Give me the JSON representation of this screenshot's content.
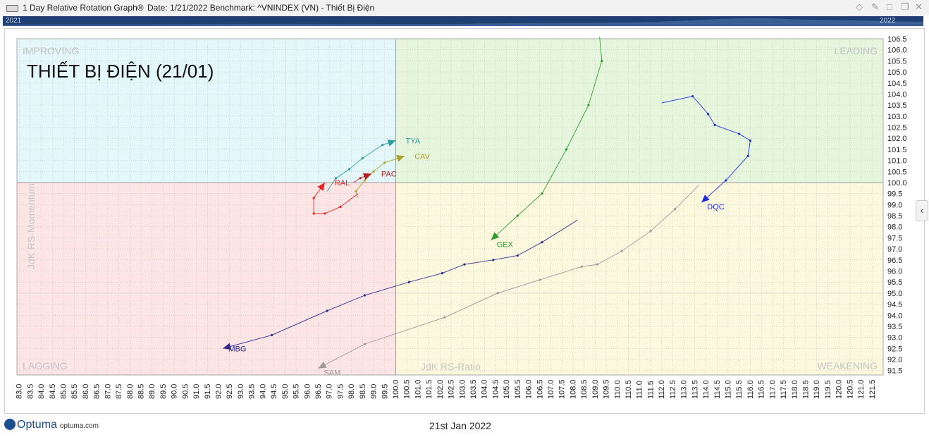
{
  "window": {
    "title": "1 Day Relative Rotation Graph®",
    "info": "Date: 1/21/2022   Benchmark:  ^VNINDEX (VN) - Thiết Bị Điện",
    "icons": [
      "pin-icon",
      "maximize-icon",
      "close-icon"
    ]
  },
  "timeline": {
    "start_label": "2021",
    "end_label": "2022"
  },
  "footer": {
    "brand": "Optuma",
    "url": "optuma.com",
    "date": "21st Jan 2022"
  },
  "colors": {
    "improving": "#e4f8fb",
    "leading": "#e6f6dd",
    "lagging": "#fde5e6",
    "weakening": "#fbf8dd",
    "timeline": "#1f3f72"
  },
  "chart_data": {
    "type": "scatter",
    "title": "THIẾT BỊ ĐIỆN (21/01)",
    "xlabel": "JdK RS-Ratio",
    "ylabel": "JdK RS-Momentum",
    "xlim": [
      82.9,
      122
    ],
    "ylim": [
      91.3,
      106.5
    ],
    "center": [
      100,
      100
    ],
    "x_ticks": [
      83.0,
      83.5,
      84.0,
      84.5,
      85.0,
      85.5,
      86.0,
      86.5,
      87.0,
      87.5,
      88.0,
      88.5,
      89.0,
      89.5,
      90.0,
      90.5,
      91.0,
      91.5,
      92.0,
      92.5,
      93.0,
      93.5,
      94.0,
      94.5,
      95.0,
      95.5,
      96.0,
      96.5,
      97.0,
      97.5,
      98.0,
      98.5,
      99.0,
      99.5,
      100.0,
      100.5,
      101.0,
      101.5,
      102.0,
      102.5,
      103.0,
      103.5,
      104.0,
      104.5,
      105.0,
      105.5,
      106.0,
      106.5,
      107.0,
      107.5,
      108.0,
      108.5,
      109.0,
      109.5,
      110.0,
      110.5,
      111.0,
      111.5,
      112.0,
      112.5,
      113.0,
      113.5,
      114.0,
      114.5,
      115.0,
      115.5,
      116.0,
      116.5,
      117.0,
      117.5,
      118.0,
      118.5,
      119.0,
      119.5,
      120.0,
      120.5,
      121.0,
      121.5
    ],
    "y_ticks": [
      91.5,
      92.0,
      92.5,
      93.0,
      93.5,
      94.0,
      94.5,
      95.0,
      95.5,
      96.0,
      96.5,
      97.0,
      97.5,
      98.0,
      98.5,
      99.0,
      99.5,
      100.0,
      100.5,
      101.0,
      101.5,
      102.0,
      102.5,
      103.0,
      103.5,
      104.0,
      104.5,
      105.0,
      105.5,
      106.0,
      106.5
    ],
    "quadrants": [
      {
        "name": "IMPROVING",
        "position": "top-left"
      },
      {
        "name": "LEADING",
        "position": "top-right"
      },
      {
        "name": "LAGGING",
        "position": "bottom-left"
      },
      {
        "name": "WEAKENING",
        "position": "bottom-right"
      }
    ],
    "series": [
      {
        "name": "TYA",
        "color": "#2a9d9d",
        "points": [
          [
            96.9,
            99.6
          ],
          [
            97.3,
            100.2
          ],
          [
            97.9,
            100.6
          ],
          [
            98.5,
            101.1
          ],
          [
            99.4,
            101.7
          ],
          [
            100.0,
            101.9
          ]
        ]
      },
      {
        "name": "CAV",
        "color": "#a9a226",
        "points": [
          [
            98.3,
            99.3
          ],
          [
            98.2,
            99.6
          ],
          [
            98.6,
            100.1
          ],
          [
            99.0,
            100.5
          ],
          [
            99.5,
            100.9
          ],
          [
            100.4,
            101.2
          ]
        ]
      },
      {
        "name": "PAC",
        "color": "#b32020",
        "points": [
          [
            98.1,
            100.0
          ],
          [
            98.4,
            100.2
          ],
          [
            98.9,
            100.4
          ]
        ]
      },
      {
        "name": "RAL",
        "color": "#e8231e",
        "points": [
          [
            98.3,
            99.5
          ],
          [
            97.5,
            98.9
          ],
          [
            96.8,
            98.6
          ],
          [
            96.3,
            98.6
          ],
          [
            96.3,
            99.3
          ],
          [
            96.8,
            100.0
          ]
        ]
      },
      {
        "name": "GEX",
        "color": "#2e9a2e",
        "points": [
          [
            109.2,
            106.6
          ],
          [
            109.3,
            105.5
          ],
          [
            108.7,
            103.5
          ],
          [
            107.7,
            101.5
          ],
          [
            106.6,
            99.5
          ],
          [
            105.5,
            98.5
          ],
          [
            104.3,
            97.4
          ]
        ]
      },
      {
        "name": "DQC",
        "color": "#1f2fd6",
        "points": [
          [
            112.0,
            103.6
          ],
          [
            113.4,
            103.9
          ],
          [
            114.1,
            103.1
          ],
          [
            114.4,
            102.6
          ],
          [
            115.5,
            102.2
          ],
          [
            116.0,
            101.9
          ],
          [
            115.9,
            101.2
          ],
          [
            114.9,
            100.1
          ],
          [
            113.8,
            99.1
          ]
        ]
      },
      {
        "name": "MBG",
        "color": "#2c2c8c",
        "points": [
          [
            108.2,
            98.3
          ],
          [
            106.6,
            97.3
          ],
          [
            105.5,
            96.7
          ],
          [
            104.4,
            96.5
          ],
          [
            103.1,
            96.3
          ],
          [
            102.1,
            95.9
          ],
          [
            100.6,
            95.5
          ],
          [
            98.6,
            94.9
          ],
          [
            96.9,
            94.2
          ],
          [
            94.4,
            93.1
          ],
          [
            92.2,
            92.5
          ]
        ]
      },
      {
        "name": "SAM",
        "color": "#9a9a9a",
        "points": [
          [
            113.7,
            99.9
          ],
          [
            112.6,
            98.8
          ],
          [
            111.5,
            97.8
          ],
          [
            110.2,
            96.9
          ],
          [
            109.1,
            96.3
          ],
          [
            108.4,
            96.2
          ],
          [
            106.5,
            95.6
          ],
          [
            104.6,
            95.0
          ],
          [
            102.2,
            93.9
          ],
          [
            98.6,
            92.7
          ],
          [
            96.5,
            91.6
          ]
        ]
      }
    ]
  }
}
